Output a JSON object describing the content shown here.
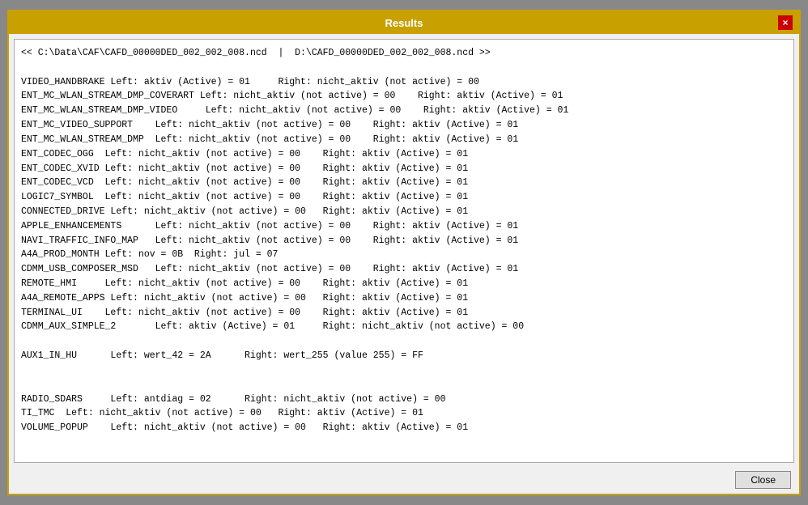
{
  "window": {
    "title": "Results",
    "close_icon": "×"
  },
  "content": {
    "lines": [
      "<< C:\\Data\\CAF\\CAFD_00000DED_002_002_008.ncd  |  D:\\CAFD_00000DED_002_002_008.ncd >>",
      "",
      "VIDEO_HANDBRAKE Left: aktiv (Active) = 01     Right: nicht_aktiv (not active) = 00",
      "ENT_MC_WLAN_STREAM_DMP_COVERART Left: nicht_aktiv (not active) = 00    Right: aktiv (Active) = 01",
      "ENT_MC_WLAN_STREAM_DMP_VIDEO     Left: nicht_aktiv (not active) = 00    Right: aktiv (Active) = 01",
      "ENT_MC_VIDEO_SUPPORT    Left: nicht_aktiv (not active) = 00    Right: aktiv (Active) = 01",
      "ENT_MC_WLAN_STREAM_DMP  Left: nicht_aktiv (not active) = 00    Right: aktiv (Active) = 01",
      "ENT_CODEC_OGG  Left: nicht_aktiv (not active) = 00    Right: aktiv (Active) = 01",
      "ENT_CODEC_XVID Left: nicht_aktiv (not active) = 00    Right: aktiv (Active) = 01",
      "ENT_CODEC_VCD  Left: nicht_aktiv (not active) = 00    Right: aktiv (Active) = 01",
      "LOGIC7_SYMBOL  Left: nicht_aktiv (not active) = 00    Right: aktiv (Active) = 01",
      "CONNECTED_DRIVE Left: nicht_aktiv (not active) = 00   Right: aktiv (Active) = 01",
      "APPLE_ENHANCEMENTS      Left: nicht_aktiv (not active) = 00    Right: aktiv (Active) = 01",
      "NAVI_TRAFFIC_INFO_MAP   Left: nicht_aktiv (not active) = 00    Right: aktiv (Active) = 01",
      "A4A_PROD_MONTH Left: nov = 0B  Right: jul = 07",
      "CDMM_USB_COMPOSER_MSD   Left: nicht_aktiv (not active) = 00    Right: aktiv (Active) = 01",
      "REMOTE_HMI     Left: nicht_aktiv (not active) = 00    Right: aktiv (Active) = 01",
      "A4A_REMOTE_APPS Left: nicht_aktiv (not active) = 00   Right: aktiv (Active) = 01",
      "TERMINAL_UI    Left: nicht_aktiv (not active) = 00    Right: aktiv (Active) = 01",
      "CDMM_AUX_SIMPLE_2       Left: aktiv (Active) = 01     Right: nicht_aktiv (not active) = 00",
      "",
      "AUX1_IN_HU      Left: wert_42 = 2A      Right: wert_255 (value 255) = FF",
      "",
      "",
      "RADIO_SDARS     Left: antdiag = 02      Right: nicht_aktiv (not active) = 00",
      "TI_TMC  Left: nicht_aktiv (not active) = 00   Right: aktiv (Active) = 01",
      "VOLUME_POPUP    Left: nicht_aktiv (not active) = 00   Right: aktiv (Active) = 01"
    ]
  },
  "footer": {
    "close_label": "Close"
  }
}
